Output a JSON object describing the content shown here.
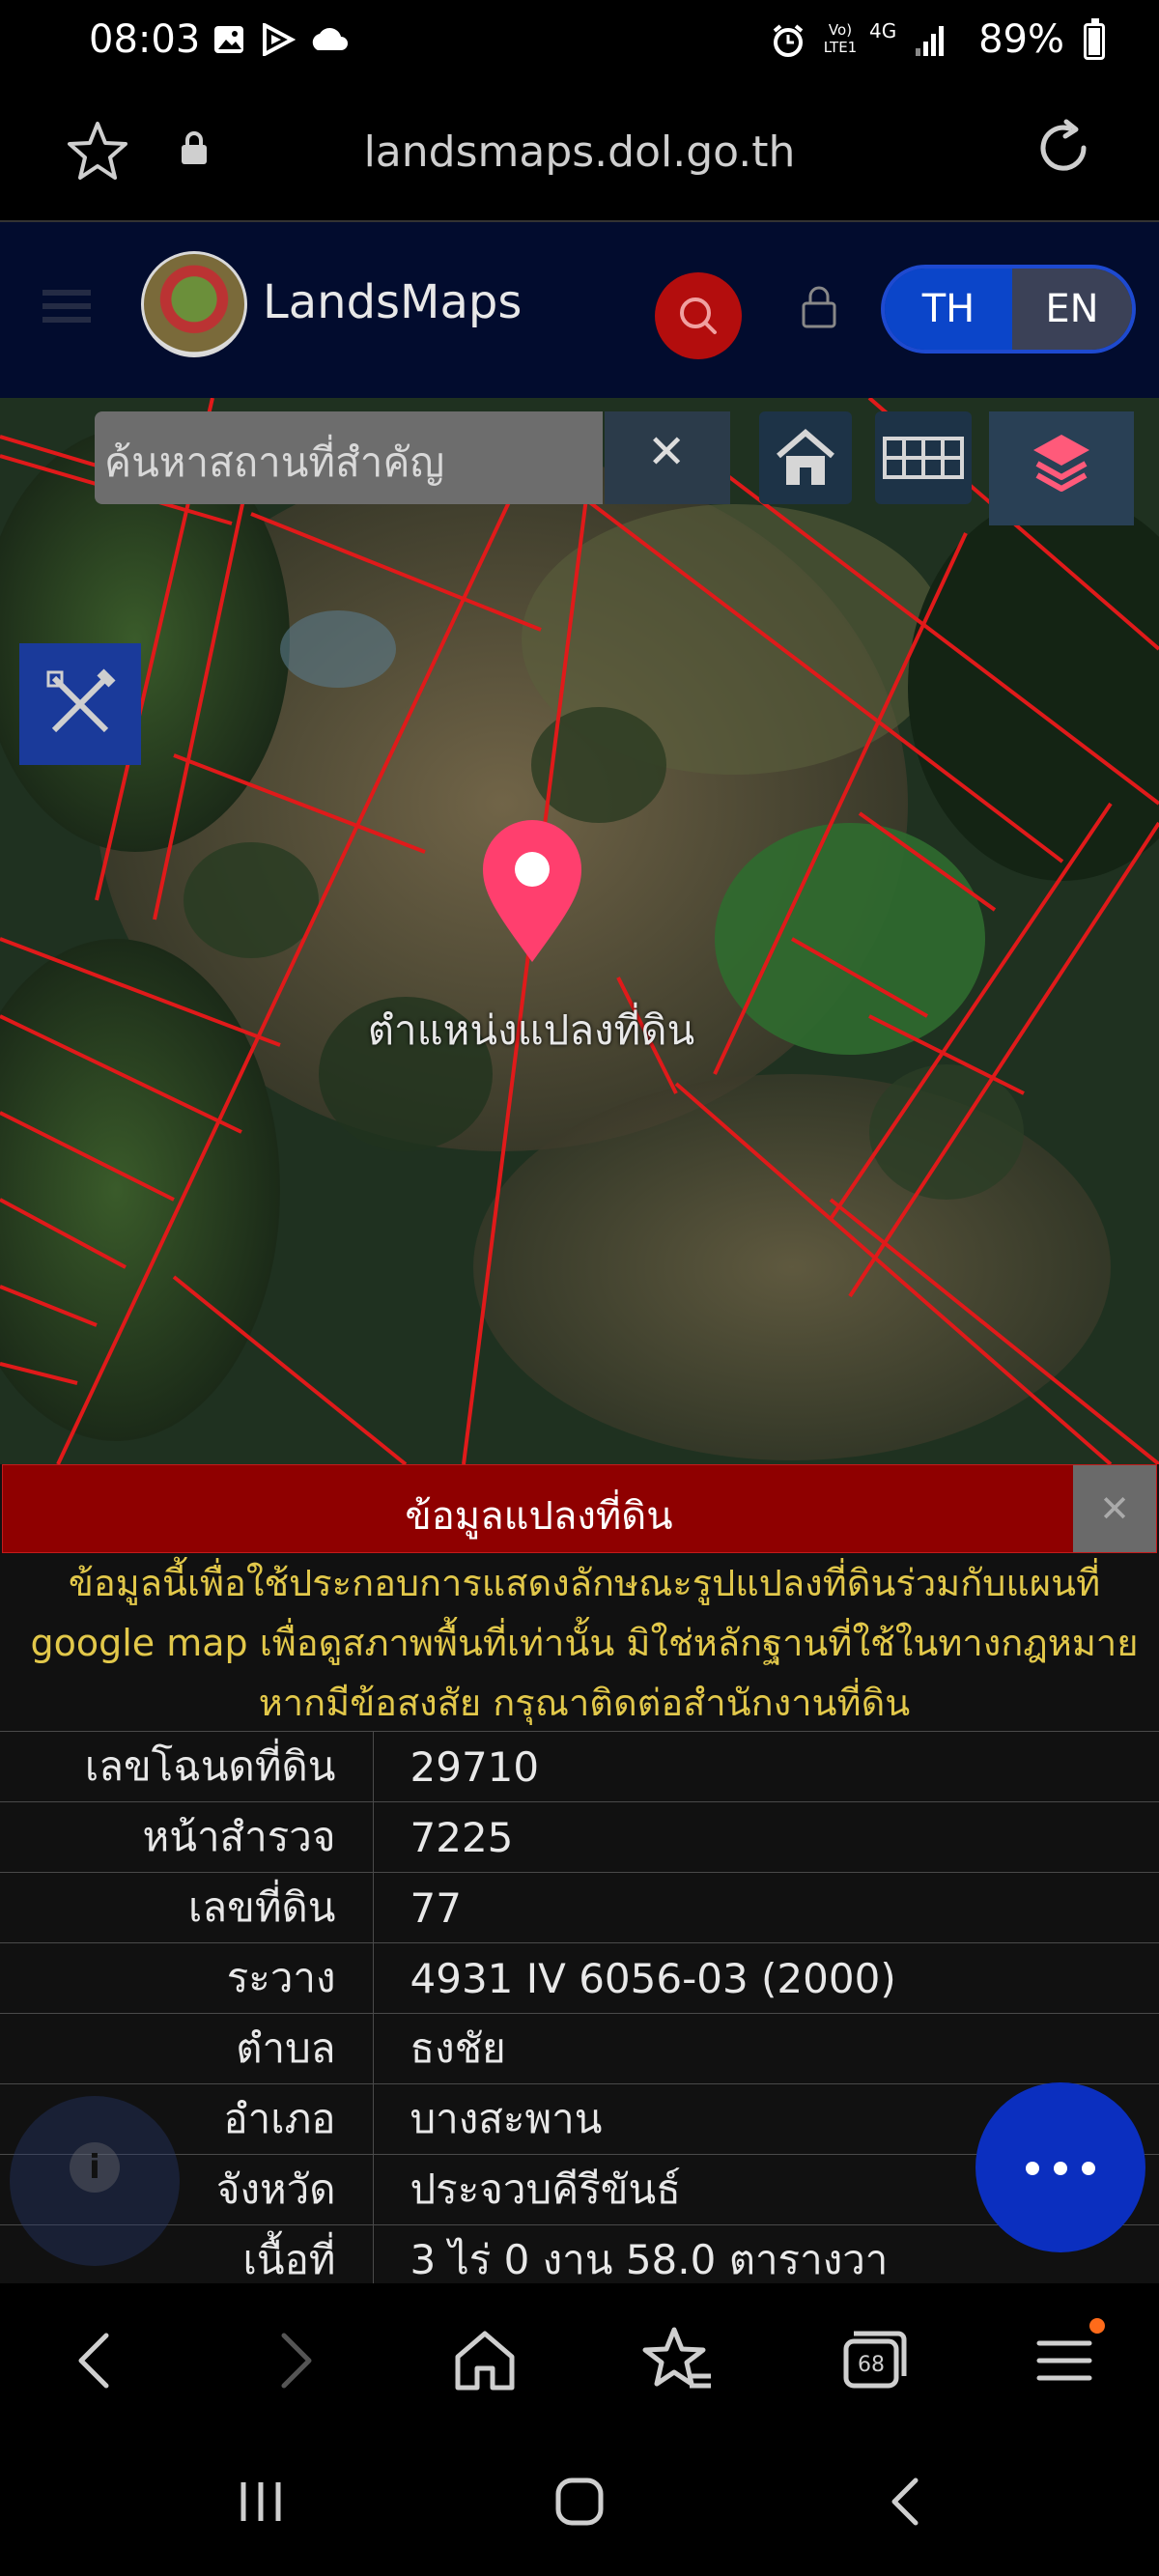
{
  "status_bar": {
    "time": "08:03",
    "network": "Vo) LTE1",
    "signal": "4G",
    "battery": "89%",
    "battery_level": 0.89
  },
  "browser": {
    "url": "landsmaps.dol.go.th",
    "tabs_count": "68"
  },
  "header": {
    "brand": "LandsMaps",
    "lang_th": "TH",
    "lang_en": "EN"
  },
  "map": {
    "search_placeholder": "ค้นหาสถานที่สำคัญ",
    "clear_symbol": "✕",
    "pin_label": "ตำแหน่งแปลงที่ดิน"
  },
  "panel": {
    "title": "ข้อมูลแปลงที่ดิน",
    "close_symbol": "✕",
    "notice_line1": "ข้อมูลนี้เพื่อใช้ประกอบการแสดงลักษณะรูปแปลงที่ดินร่วมกับแผนที่",
    "notice_line2": "google map เพื่อดูสภาพพื้นที่เท่านั้น มิใช่หลักฐานที่ใช้ในทางกฎหมาย",
    "notice_line3": "หากมีข้อสงสัย กรุณาติดต่อสำนักงานที่ดิน",
    "rows": [
      {
        "label": "เลขโฉนดที่ดิน",
        "value": "29710"
      },
      {
        "label": "หน้าสำรวจ",
        "value": "7225"
      },
      {
        "label": "เลขที่ดิน",
        "value": "77"
      },
      {
        "label": "ระวาง",
        "value": "4931 IV 6056-03 (2000)"
      },
      {
        "label": "ตำบล",
        "value": "ธงชัย"
      },
      {
        "label": "อำเภอ",
        "value": "บางสะพาน"
      },
      {
        "label": "จังหวัด",
        "value": "ประจวบคีรีขันธ์"
      },
      {
        "label": "เนื้อที่",
        "value": "3 ไร่ 0 งาน 58.0 ตารางวา"
      }
    ]
  },
  "colors": {
    "header_bg": "#020c2e",
    "accent_red": "#8f0000",
    "lang_active": "#0b45c9",
    "notice_text": "#e2c84a",
    "parcel_lines": "#e01a1a",
    "pin": "#ff3f6e"
  },
  "icons": [
    "star-icon",
    "lock-icon",
    "reload-icon",
    "menu-icon",
    "search-icon",
    "home-icon",
    "grid-icon",
    "layers-icon",
    "draw-tools-icon",
    "map-pin-icon",
    "info-icon",
    "more-icon",
    "back-icon",
    "forward-icon",
    "bookmarks-icon",
    "tabs-icon"
  ]
}
